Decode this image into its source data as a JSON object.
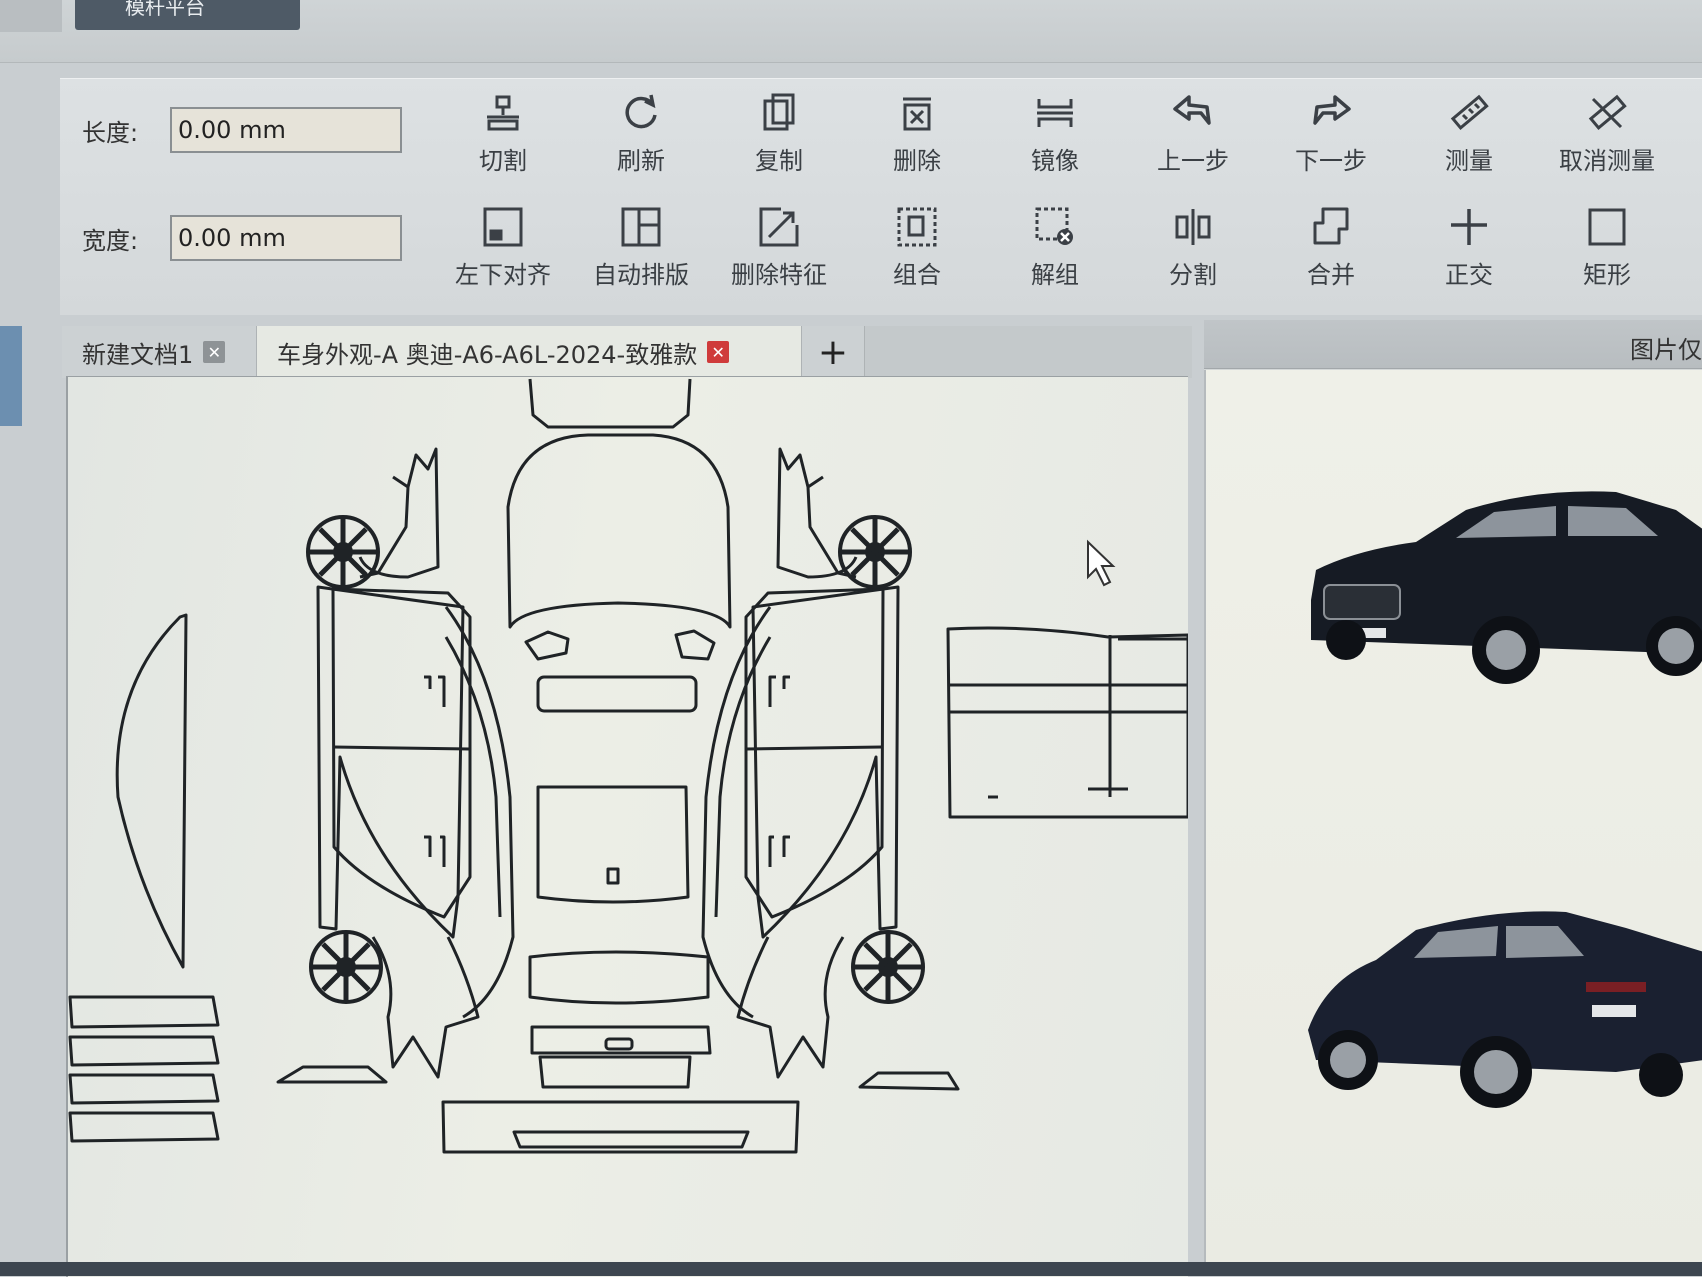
{
  "top_tab": {
    "label": "模杆平台"
  },
  "fields": {
    "length": {
      "label": "长度:",
      "value": "0.00 mm"
    },
    "width": {
      "label": "宽度:",
      "value": "0.00 mm"
    }
  },
  "toolbar": {
    "row1": [
      {
        "label": "切割",
        "icon": "cut-icon"
      },
      {
        "label": "刷新",
        "icon": "refresh-icon"
      },
      {
        "label": "复制",
        "icon": "copy-icon"
      },
      {
        "label": "删除",
        "icon": "delete-icon"
      },
      {
        "label": "镜像",
        "icon": "mirror-icon"
      },
      {
        "label": "上一步",
        "icon": "undo-icon"
      },
      {
        "label": "下一步",
        "icon": "redo-icon"
      },
      {
        "label": "测量",
        "icon": "ruler-icon"
      },
      {
        "label": "取消测量",
        "icon": "cancel-ruler-icon"
      }
    ],
    "row2": [
      {
        "label": "左下对齐",
        "icon": "align-bottom-left-icon"
      },
      {
        "label": "自动排版",
        "icon": "auto-layout-icon"
      },
      {
        "label": "删除特征",
        "icon": "delete-feature-icon"
      },
      {
        "label": "组合",
        "icon": "group-icon"
      },
      {
        "label": "解组",
        "icon": "ungroup-icon"
      },
      {
        "label": "分割",
        "icon": "split-icon"
      },
      {
        "label": "合并",
        "icon": "merge-icon"
      },
      {
        "label": "正交",
        "icon": "orthogonal-icon"
      },
      {
        "label": "矩形",
        "icon": "rectangle-icon"
      }
    ]
  },
  "tabs": [
    {
      "label": "新建文档1",
      "active": false
    },
    {
      "label": "车身外观-A 奥迪-A6-A6L-2024-致雅款",
      "active": true
    }
  ],
  "add_tab_label": "+",
  "right_panel": {
    "title": "图片仅"
  },
  "colors": {
    "accent_close": "#cf3b3b",
    "toolbar_bg": "#d8dcde",
    "canvas_bg": "#e8eae4"
  }
}
